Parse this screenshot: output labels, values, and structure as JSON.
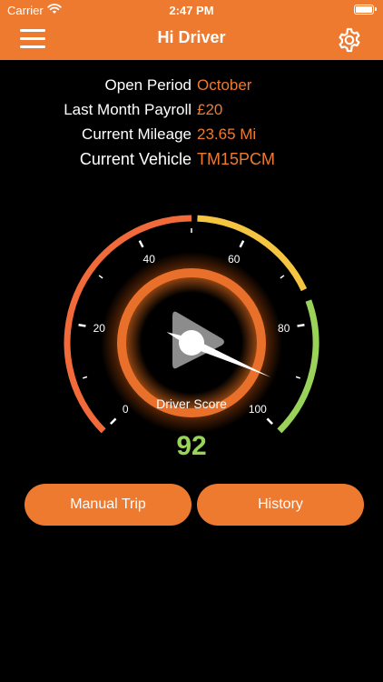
{
  "status_bar": {
    "carrier": "Carrier",
    "time": "2:47 PM"
  },
  "header": {
    "title": "Hi Driver",
    "menu_icon": "hamburger-icon",
    "settings_icon": "gear-icon"
  },
  "info": {
    "open_period": {
      "label": "Open Period",
      "value": "October"
    },
    "last_month_payroll": {
      "label": "Last Month Payroll",
      "value": "£20"
    },
    "current_mileage": {
      "label": "Current Mileage",
      "value": "23.65 Mi"
    },
    "current_vehicle": {
      "label": "Current Vehicle",
      "value": "TM15PCM"
    }
  },
  "gauge": {
    "min": 0,
    "max": 100,
    "tick_labels": [
      "0",
      "20",
      "40",
      "60",
      "80",
      "100"
    ],
    "value": 92,
    "label": "Driver Score",
    "score_text": "92",
    "colors": {
      "low": "#f26a3a",
      "mid": "#f5c542",
      "high": "#9ad35a",
      "ring": "#e8702a"
    },
    "center_icon": "play-icon"
  },
  "buttons": {
    "manual_trip": "Manual Trip",
    "history": "History"
  },
  "accent": "#ee7a30"
}
